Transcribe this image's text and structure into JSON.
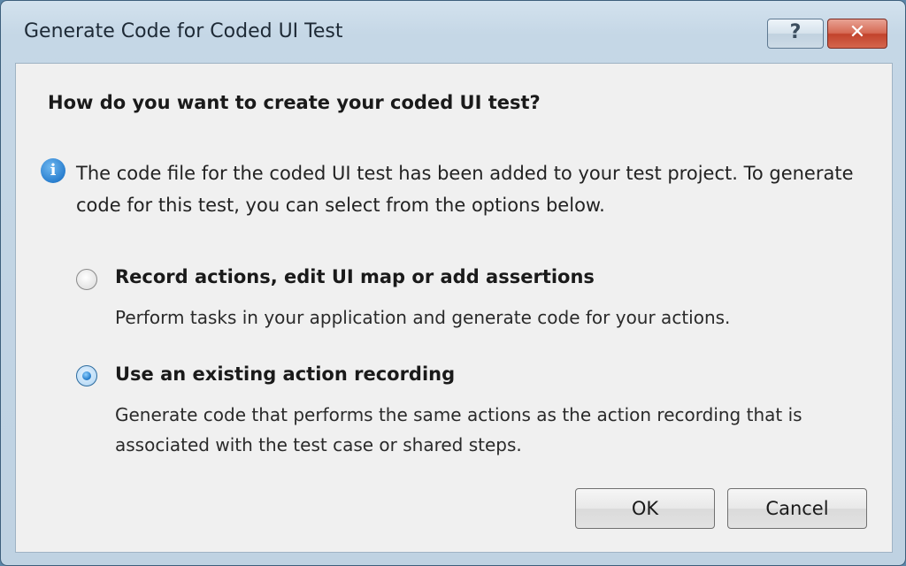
{
  "window": {
    "title": "Generate Code for Coded UI Test",
    "help_label": "?",
    "close_label": "✕"
  },
  "dialog": {
    "heading": "How do you want to create your coded UI test?",
    "info_text": "The code file for the coded UI test has been added to your test project. To generate code for this test, you can select from the options below.",
    "options": [
      {
        "label": "Record actions, edit UI map or add assertions",
        "description": "Perform tasks in your application and generate code for your actions.",
        "selected": false
      },
      {
        "label": "Use an existing action recording",
        "description": "Generate code that performs the same actions as the action recording that is associated with the test case or shared steps.",
        "selected": true
      }
    ],
    "ok_label": "OK",
    "cancel_label": "Cancel"
  },
  "colors": {
    "accent": "#1f78c8",
    "close_button": "#c2432c"
  },
  "icons": {
    "info": "info-icon",
    "help": "help-icon",
    "close": "close-icon"
  }
}
